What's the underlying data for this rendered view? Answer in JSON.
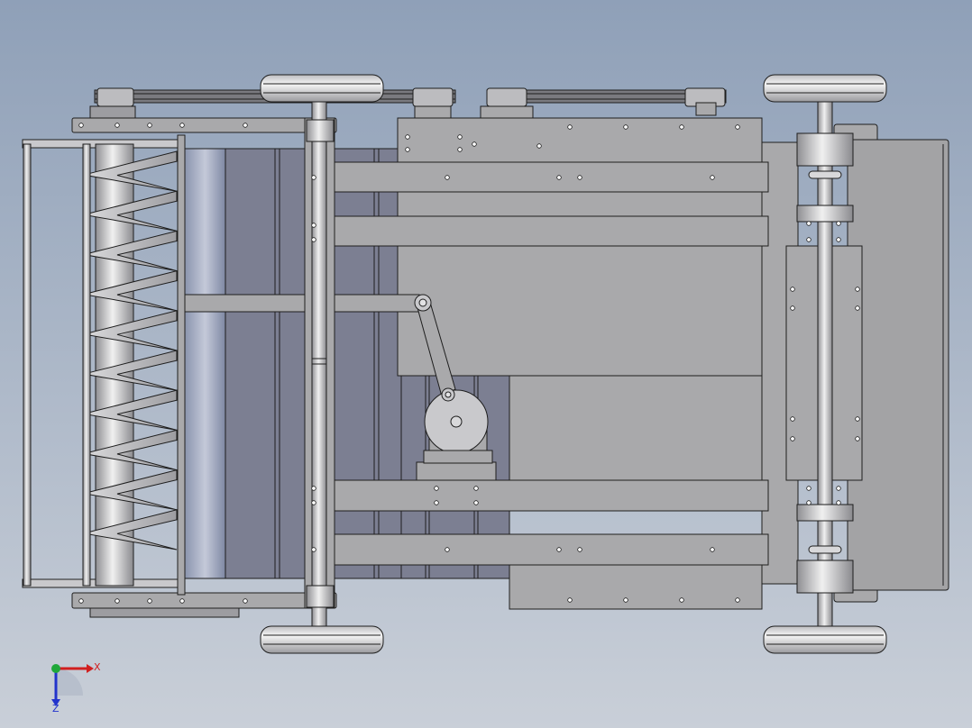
{
  "viewport": {
    "background_top": "#8fa0b8",
    "background_bottom": "#c9cfd8"
  },
  "colors": {
    "frame_fill": "#a9a9ab",
    "panel_fill": "#a3a3a5",
    "dark_panel": "#7c7f92",
    "shaft_fill": "#c9c9cc",
    "wheel_fill": "#e2e2e4",
    "belt_fill": "#6f6f74",
    "edge": "#1e1e1e",
    "axis_x": "#d11f1f",
    "axis_y": "#1fa83a",
    "axis_z": "#2233cc"
  },
  "triad": {
    "x_label": "X",
    "z_label": "Z"
  },
  "icons": {
    "triad": "coordinate-triad-icon"
  }
}
